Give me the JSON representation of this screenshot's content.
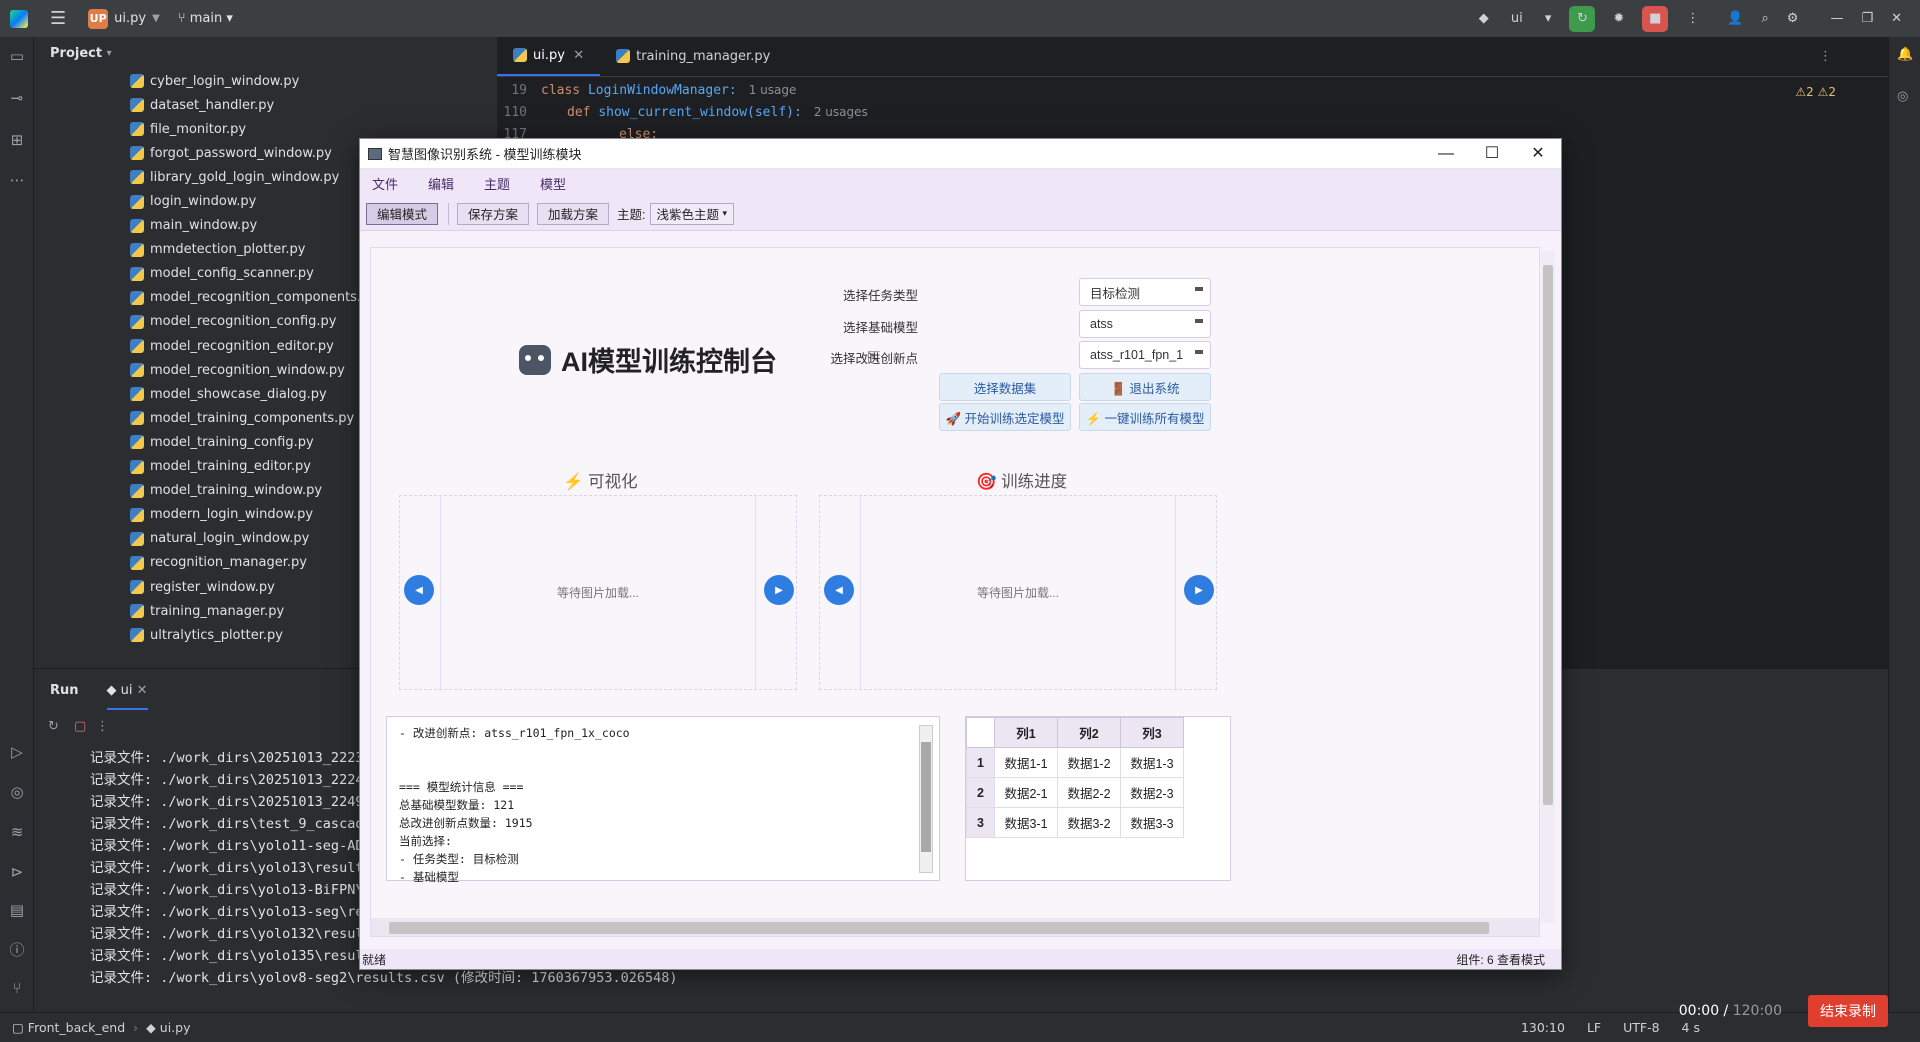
{
  "ide": {
    "project_badge": "UP",
    "project_name": "ui.py",
    "branch": "main",
    "run_config": "ui"
  },
  "project_panel": {
    "title": "Project",
    "files": [
      "cyber_login_window.py",
      "dataset_handler.py",
      "file_monitor.py",
      "forgot_password_window.py",
      "library_gold_login_window.py",
      "login_window.py",
      "main_window.py",
      "mmdetection_plotter.py",
      "model_config_scanner.py",
      "model_recognition_components.py",
      "model_recognition_config.py",
      "model_recognition_editor.py",
      "model_recognition_window.py",
      "model_showcase_dialog.py",
      "model_training_components.py",
      "model_training_config.py",
      "model_training_editor.py",
      "model_training_window.py",
      "modern_login_window.py",
      "natural_login_window.py",
      "recognition_manager.py",
      "register_window.py",
      "training_manager.py",
      "ultralytics_plotter.py"
    ]
  },
  "editor": {
    "tabs": [
      "ui.py",
      "training_manager.py"
    ],
    "warnings": "⚠2  ⚠2",
    "lines": [
      {
        "num": "19",
        "kw": "class",
        "name": "LoginWindowManager:",
        "hint": "1 usage"
      },
      {
        "num": "110",
        "kw": "def",
        "name": "show_current_window(self):",
        "hint": "2 usages"
      },
      {
        "num": "117",
        "kw": "else:",
        "name": "",
        "hint": ""
      }
    ]
  },
  "run_panel": {
    "title": "Run",
    "tab": "ui",
    "lines": [
      "记录文件: ./work_dirs\\20251013_2223",
      "记录文件: ./work_dirs\\20251013_2224",
      "记录文件: ./work_dirs\\20251013_2249",
      "记录文件: ./work_dirs\\test_9_cascad",
      "记录文件: ./work_dirs\\yolo11-seg-AD",
      "记录文件: ./work_dirs\\yolo13\\result",
      "记录文件: ./work_dirs\\yolo13-BiFPN\\",
      "记录文件: ./work_dirs\\yolo13-seg\\re",
      "记录文件: ./work_dirs\\yolo132\\resul",
      "记录文件: ./work_dirs\\yolo135\\resul",
      "记录文件: ./work_dirs\\yolov8-seg2\\results.csv (修改时间: 1760367953.026548)"
    ]
  },
  "statusbar": {
    "path_root": "Front_back_end",
    "path_file": "ui.py",
    "position": "130:10",
    "line_sep": "LF",
    "encoding": "UTF-8",
    "indent": "4 s"
  },
  "recording": {
    "elapsed": "00:00",
    "total": "120:00",
    "stop_label": "结束录制"
  },
  "app": {
    "window_title": "智慧图像识别系统 - 模型训练模块",
    "menu": [
      "文件",
      "编辑",
      "主题",
      "模型"
    ],
    "toolbar": {
      "edit_mode": "编辑模式",
      "save_plan": "保存方案",
      "load_plan": "加载方案",
      "theme_label": "主题:",
      "theme_value": "浅紫色主题"
    },
    "panel_title": "AI模型训练控制台",
    "form": {
      "task_label": "选择任务类型",
      "task_value": "目标检测",
      "base_label": "选择基础模型",
      "base_value": "atss",
      "innov_label": "选择改进创新点",
      "innov_value": "atss_r101_fpn_1"
    },
    "buttons": {
      "select_dataset": "选择数据集",
      "exit": "🚪 退出系统",
      "start_selected": "🚀 开始训练选定模型",
      "train_all": "⚡ 一键训练所有模型"
    },
    "visual_title": "⚡ 可视化",
    "progress_title": "🎯 训练进度",
    "waiting_text": "等待图片加载...",
    "log_lines": [
      "- 改进创新点: atss_r101_fpn_1x_coco",
      "",
      "",
      "=== 模型统计信息 ===",
      "总基础模型数量: 121",
      "总改进创新点数量: 1915",
      "当前选择:",
      "- 任务类型: 目标检测",
      "- 基础模型"
    ],
    "table": {
      "headers": [
        "列1",
        "列2",
        "列3"
      ],
      "rows": [
        {
          "idx": "1",
          "cells": [
            "数据1-1",
            "数据1-2",
            "数据1-3"
          ]
        },
        {
          "idx": "2",
          "cells": [
            "数据2-1",
            "数据2-2",
            "数据2-3"
          ]
        },
        {
          "idx": "3",
          "cells": [
            "数据3-1",
            "数据3-2",
            "数据3-3"
          ]
        }
      ]
    },
    "status_left": "就绪",
    "status_right": "组件: 6  查看模式"
  },
  "colors": {
    "accent_blue": "#3574f0",
    "app_lavender": "#efe6f7",
    "nav_button_blue": "#2f7de1",
    "record_red": "#e03e2f"
  }
}
